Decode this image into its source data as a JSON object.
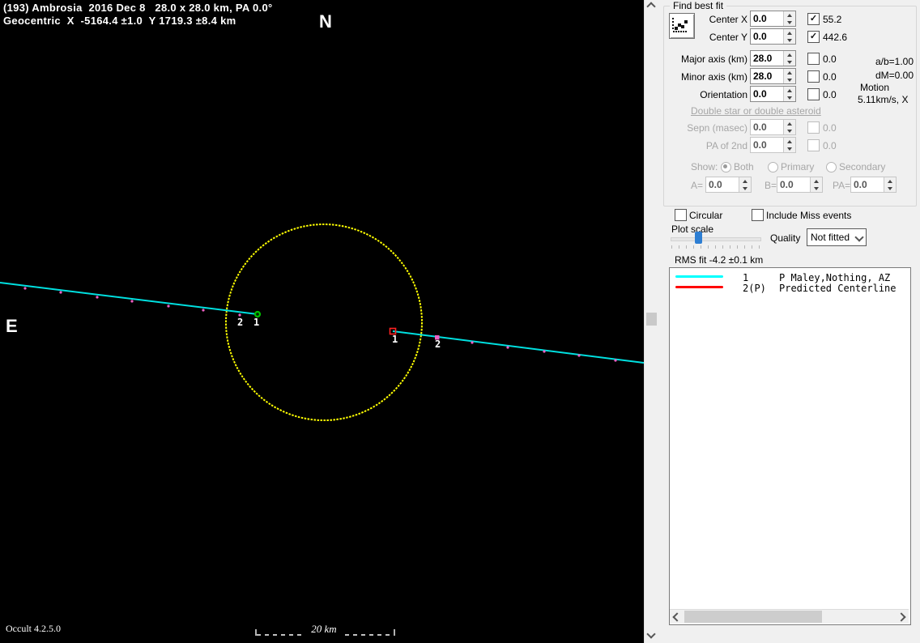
{
  "plot": {
    "title_line1": "(193) Ambrosia  2016 Dec 8   28.0 x 28.0 km, PA 0.0°",
    "title_line2": "Geocentric  X  -5164.4 ±1.0  Y 1719.3 ±8.4 km",
    "north_label": "N",
    "east_label": "E",
    "scale_label": "20 km",
    "version": "Occult 4.2.5.0",
    "marker_labels": {
      "left_chord2": "2",
      "left_chord1": "1",
      "right_chord1": "1",
      "right_chord2": "2"
    },
    "colors": {
      "background": "#000000",
      "ellipse": "#ffff00",
      "chord": "#00e0e0",
      "disappearance_marker": "#00c000",
      "reappearance_marker": "#ff2222",
      "predicted_ticks": "#ef5fc4"
    }
  },
  "panel": {
    "find_best_fit": {
      "title": "Find best fit",
      "center_x": {
        "label": "Center X",
        "value": "0.0",
        "checked": true,
        "check_value": "55.2"
      },
      "center_y": {
        "label": "Center Y",
        "value": "0.0",
        "checked": true,
        "check_value": "442.6"
      },
      "major_axis": {
        "label": "Major axis (km)",
        "value": "28.0",
        "checked": false,
        "check_value": "0.0"
      },
      "minor_axis": {
        "label": "Minor axis (km)",
        "value": "28.0",
        "checked": false,
        "check_value": "0.0"
      },
      "orientation": {
        "label": "Orientation",
        "value": "0.0",
        "checked": false,
        "check_value": "0.0"
      },
      "ab_ratio": "a/b=1.00",
      "dm": "dM=0.00",
      "motion_label": "Motion",
      "motion_value": "5.11km/s, X"
    },
    "double_star": {
      "link": "Double star or double asteroid",
      "sepn": {
        "label": "Sepn (masec)",
        "value": "0.0",
        "check_value": "0.0"
      },
      "pa_2nd": {
        "label": "PA of 2nd",
        "value": "0.0",
        "check_value": "0.0"
      },
      "show_label": "Show:",
      "options": {
        "both": "Both",
        "primary": "Primary",
        "secondary": "Secondary"
      },
      "a_label": "A=",
      "a_value": "0.0",
      "b_label": "B=",
      "b_value": "0.0",
      "pa_label": "PA=",
      "pa_value": "0.0"
    },
    "fit_options": {
      "circular": "Circular",
      "include_miss": "Include Miss events",
      "plot_scale": "Plot scale",
      "quality_label": "Quality",
      "quality_value": "Not fitted"
    },
    "rms": "RMS fit -4.2 ±0.1 km",
    "legend": [
      {
        "id": "1",
        "name": "P Maley,Nothing, AZ",
        "color": "#00ffff"
      },
      {
        "id": "2(P)",
        "name": "Predicted Centerline",
        "color": "#ff0000"
      }
    ],
    "icons": {
      "iconbtn": "scatter-plot-icon",
      "combo": "chevron-down-icon",
      "scrollbars": "chevron-arrows"
    }
  }
}
